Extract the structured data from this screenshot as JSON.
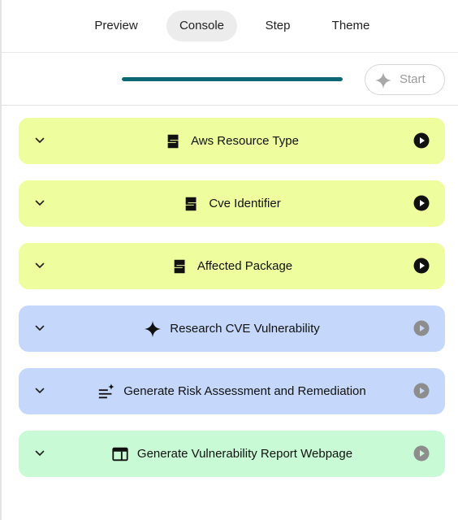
{
  "tabs": [
    {
      "label": "Preview",
      "active": false
    },
    {
      "label": "Console",
      "active": true
    },
    {
      "label": "Step",
      "active": false
    },
    {
      "label": "Theme",
      "active": false
    }
  ],
  "toolbar": {
    "progress": 1.0,
    "progress_color": "#0b6771",
    "start_label": "Start",
    "start_icon": "sparkle-icon"
  },
  "steps": [
    {
      "title": "Aws Resource Type",
      "icon": "input-field-icon",
      "color": "#eefd9e",
      "run_enabled": true
    },
    {
      "title": "Cve Identifier",
      "icon": "input-field-icon",
      "color": "#eefd9e",
      "run_enabled": true
    },
    {
      "title": "Affected Package",
      "icon": "input-field-icon",
      "color": "#eefd9e",
      "run_enabled": true
    },
    {
      "title": "Research CVE Vulnerability",
      "icon": "sparkle-icon",
      "color": "#c5d8fb",
      "run_enabled": false
    },
    {
      "title": "Generate Risk Assessment and Remediation",
      "icon": "text-sparkle-icon",
      "color": "#c5d8fb",
      "run_enabled": false
    },
    {
      "title": "Generate Vulnerability Report Webpage",
      "icon": "web-window-icon",
      "color": "#c8fbd5",
      "run_enabled": false
    }
  ]
}
